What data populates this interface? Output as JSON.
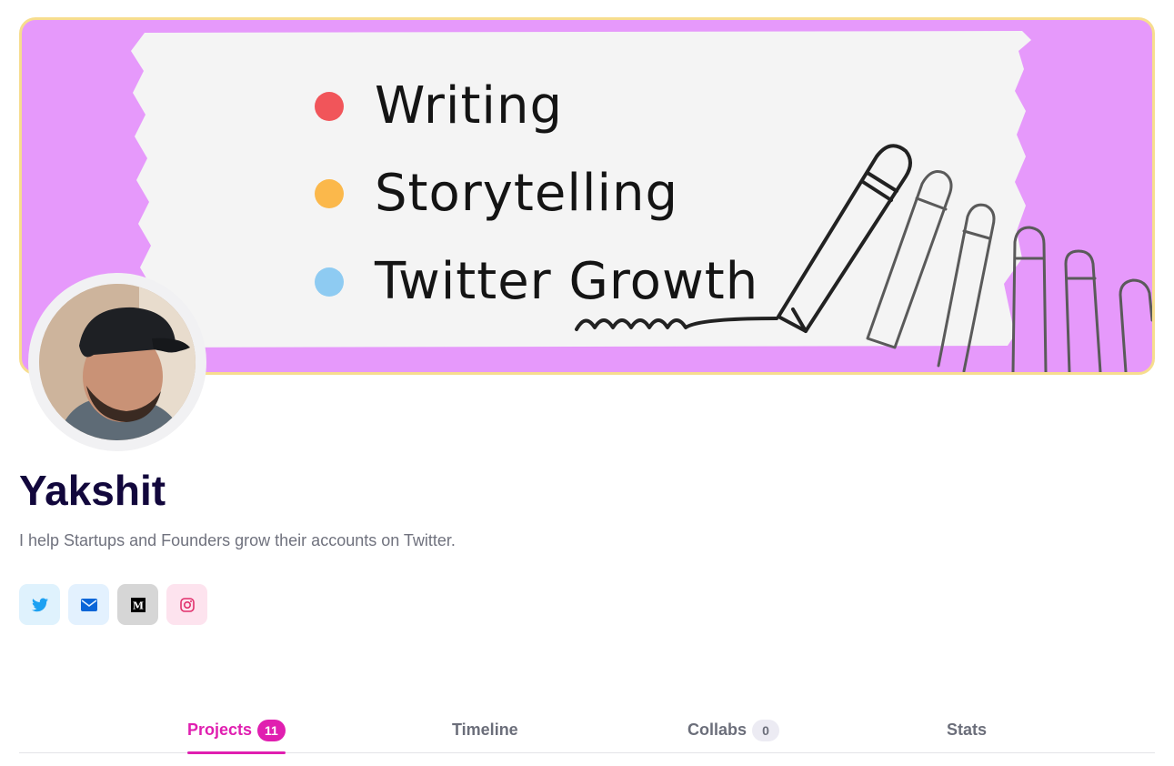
{
  "banner": {
    "items": [
      {
        "label": "Writing",
        "dot_color": "#f1555a"
      },
      {
        "label": "Storytelling",
        "dot_color": "#fbb84b"
      },
      {
        "label": "Twitter Growth",
        "dot_color": "#8ecbf2"
      }
    ],
    "background_color": "#e699fb",
    "border_color": "#f7dd8e"
  },
  "profile": {
    "name": "Yakshit",
    "bio": "I help Startups and Founders grow their accounts on Twitter."
  },
  "socials": [
    {
      "icon": "twitter-icon",
      "bg": "#dff2fd",
      "color": "#1da1f2"
    },
    {
      "icon": "mail-icon",
      "bg": "#e3f1fe",
      "color": "#0a66d8"
    },
    {
      "icon": "medium-icon",
      "bg": "#d6d6d6",
      "color": "#000000"
    },
    {
      "icon": "instagram-icon",
      "bg": "#fde3ee",
      "color": "#e1306c"
    }
  ],
  "tabs": [
    {
      "label": "Projects",
      "badge": "11",
      "active": true
    },
    {
      "label": "Timeline"
    },
    {
      "label": "Collabs",
      "badge": "0"
    },
    {
      "label": "Stats"
    }
  ],
  "colors": {
    "accent": "#e01fb0",
    "name": "#12073c",
    "muted_text": "#6b6e7a"
  }
}
